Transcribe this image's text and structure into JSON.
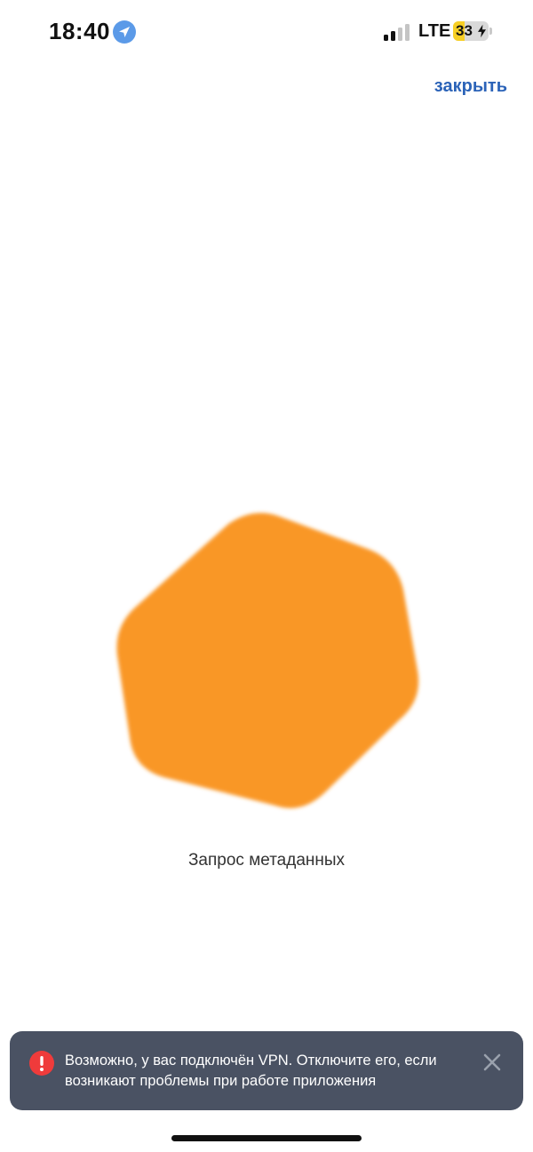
{
  "status_bar": {
    "time": "18:40",
    "network": "LTE",
    "battery_percent": "33",
    "battery_level": 0.33,
    "location_icon": "location-arrow-icon",
    "signal_icon": "cellular-signal-icon",
    "charging_icon": "lightning-bolt-icon"
  },
  "header": {
    "close_label": "закрыть"
  },
  "loader": {
    "icon": "hexagon-loader-icon",
    "color": "#f99727",
    "caption": "Запрос метаданных"
  },
  "toast": {
    "icon": "error-exclamation-icon",
    "message": "Возможно, у вас подключён VPN. Отключите его, если возникают проблемы при работе приложения",
    "close_icon": "close-icon",
    "background": "#4a5263",
    "icon_color": "#ef3b3b"
  },
  "colors": {
    "accent": "#2b63b8"
  }
}
